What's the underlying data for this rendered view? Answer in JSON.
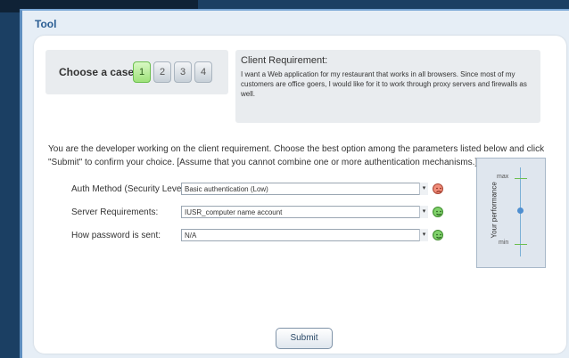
{
  "tool": {
    "title": "Tool"
  },
  "case_selector": {
    "label": "Choose a case:",
    "cases": [
      "1",
      "2",
      "3",
      "4"
    ],
    "active_case": "1"
  },
  "client_requirement": {
    "title": "Client Requirement:",
    "text": "I want a Web application for my restaurant that works in all browsers. Since most of my customers are office goers, I would like for it to work through proxy servers and firewalls as well."
  },
  "instructions": {
    "text": "You are the developer working on the client requirement. Choose the best option among the parameters listed below and click \"Submit\" to confirm your choice. [Assume that you cannot combine one or more authentication mechanisms.]"
  },
  "parameters": [
    {
      "label": "Auth Method (Security Level):",
      "value": "Basic authentication (Low)",
      "status": "sad"
    },
    {
      "label": "Server Requirements:",
      "value": "IUSR_computer name account",
      "status": "happy"
    },
    {
      "label": "How password is sent:",
      "value": "N/A",
      "status": "happy"
    }
  ],
  "performance": {
    "title": "Your performance",
    "max_label": "max",
    "min_label": "min",
    "level": 0.5
  },
  "submit": {
    "label": "Submit"
  },
  "colors": {
    "accent": "#2a5d93",
    "good": "#7fd16a",
    "bad": "#f08c7a"
  },
  "icons": {
    "happy": "happy-face-icon",
    "sad": "sad-face-icon"
  }
}
